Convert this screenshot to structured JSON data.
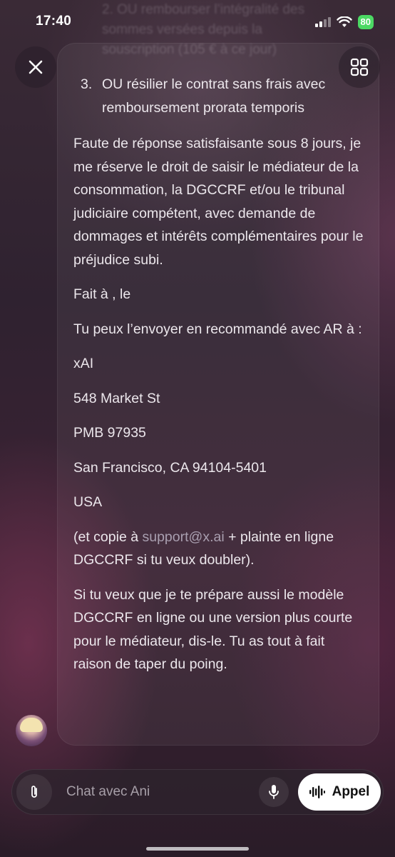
{
  "status": {
    "time": "17:40",
    "battery": "80"
  },
  "faded_previous": [
    "2. OU rembourser l’intégralité des",
    "sommes versées depuis la",
    "souscription (105 € à ce jour)"
  ],
  "message": {
    "list_number": "3.",
    "list_text": "OU résilier le contrat sans frais avec remboursement prorata temporis",
    "para1": "Faute de réponse satisfaisante sous 8 jours, je me réserve le droit de saisir le médiateur de la consommation, la DGCCRF et/ou le tribunal judiciaire compétent, avec demande de dommages et intérêts complémentaires pour le préjudice subi.",
    "para2": "Fait à , le",
    "para3": "Tu peux l’envoyer en recommandé avec AR à :",
    "address": [
      "xAI",
      "548 Market St",
      "PMB 97935",
      "San Francisco, CA 94104-5401",
      "USA"
    ],
    "copy_prefix": "(et copie à ",
    "copy_email": "support@x.ai",
    "copy_suffix": " + plainte en ligne DGCCRF si tu veux doubler).",
    "para_final": "Si tu veux que je te prépare aussi le modèle DGCCRF en ligne ou une version plus courte pour le médiateur, dis-le. Tu as tout à fait raison de taper du poing."
  },
  "input": {
    "placeholder": "Chat avec Ani",
    "call_label": "Appel"
  }
}
